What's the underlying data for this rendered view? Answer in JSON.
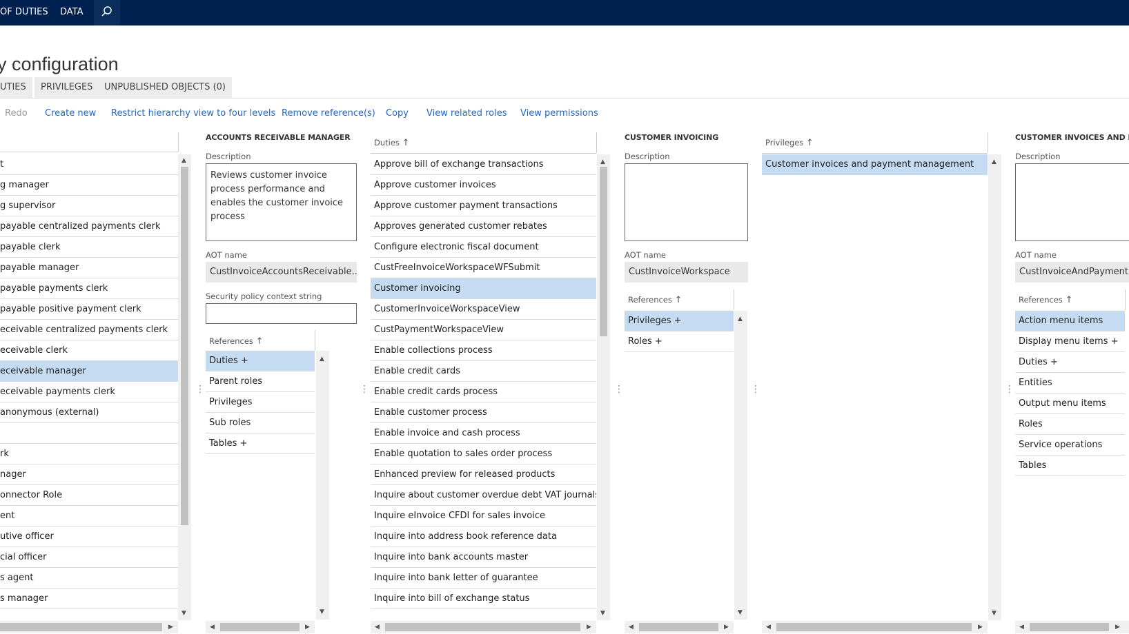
{
  "nav": {
    "item1": "OF DUTIES",
    "item2": "DATA",
    "search_icon": "search-icon"
  },
  "title": "y configuration",
  "tabs": [
    "UTIES",
    "PRIVILEGES",
    "UNPUBLISHED OBJECTS (0)"
  ],
  "actions": {
    "redo": "Redo",
    "create_new": "Create new",
    "restrict": "Restrict hierarchy view to four levels",
    "remove_refs": "Remove reference(s)",
    "copy": "Copy",
    "view_related": "View related roles",
    "view_permissions": "View permissions"
  },
  "roles_list": [
    "t",
    "g manager",
    "g supervisor",
    "payable centralized payments clerk",
    "payable clerk",
    "payable manager",
    "payable payments clerk",
    "payable positive payment clerk",
    "eceivable centralized payments clerk",
    "eceivable clerk",
    "eceivable manager",
    "eceivable payments clerk",
    "anonymous (external)",
    "",
    "rk",
    "nager",
    "onnector Role",
    "ent",
    "utive officer",
    "cial officer",
    "s agent",
    "s manager"
  ],
  "role_panel": {
    "header": "ACCOUNTS RECEIVABLE MANAGER",
    "description_label": "Description",
    "description": "Reviews customer invoice process performance and enables the customer invoice process",
    "aot_label": "AOT name",
    "aot_value": "CustInvoiceAccountsReceivable...",
    "policy_label": "Security policy context string",
    "references_label": "References",
    "references": [
      "Duties +",
      "Parent roles",
      "Privileges",
      "Sub roles",
      "Tables +"
    ]
  },
  "duties": {
    "header": "Duties",
    "items": [
      "Approve bill of exchange transactions",
      "Approve customer invoices",
      "Approve customer payment transactions",
      "Approves generated customer rebates",
      "Configure electronic fiscal document",
      "CustFreeInvoiceWorkspaceWFSubmit",
      "Customer invoicing",
      "CustomerInvoiceWorkspaceView",
      "CustPaymentWorkspaceView",
      "Enable collections process",
      "Enable credit cards",
      "Enable credit cards process",
      "Enable customer process",
      "Enable invoice and cash process",
      "Enable quotation to sales order process",
      "Enhanced preview for released products",
      "Inquire about customer overdue debt VAT journals",
      "Inquire eInvoice CFDI for sales invoice",
      "Inquire into address book reference data",
      "Inquire into bank accounts master",
      "Inquire into bank letter of guarantee",
      "Inquire into bill of exchange status"
    ]
  },
  "duty_panel": {
    "header": "CUSTOMER INVOICING",
    "description_label": "Description",
    "aot_label": "AOT name",
    "aot_value": "CustInvoiceWorkspace",
    "references_label": "References",
    "references": [
      "Privileges +",
      "Roles +"
    ]
  },
  "privileges": {
    "header": "Privileges",
    "items": [
      "Customer invoices and payment management"
    ]
  },
  "priv_panel": {
    "header": "CUSTOMER INVOICES AND PAYI",
    "description_label": "Description",
    "aot_label": "AOT name",
    "aot_value": "CustInvoiceAndPaymentM",
    "references_label": "References",
    "references": [
      "Action menu items",
      "Display menu items +",
      "Duties +",
      "Entities",
      "Output menu items",
      "Roles",
      "Service operations",
      "Tables"
    ]
  },
  "colors": {
    "topbar": "#002050",
    "link": "#2266c8",
    "selected": "#c5dbf1"
  }
}
